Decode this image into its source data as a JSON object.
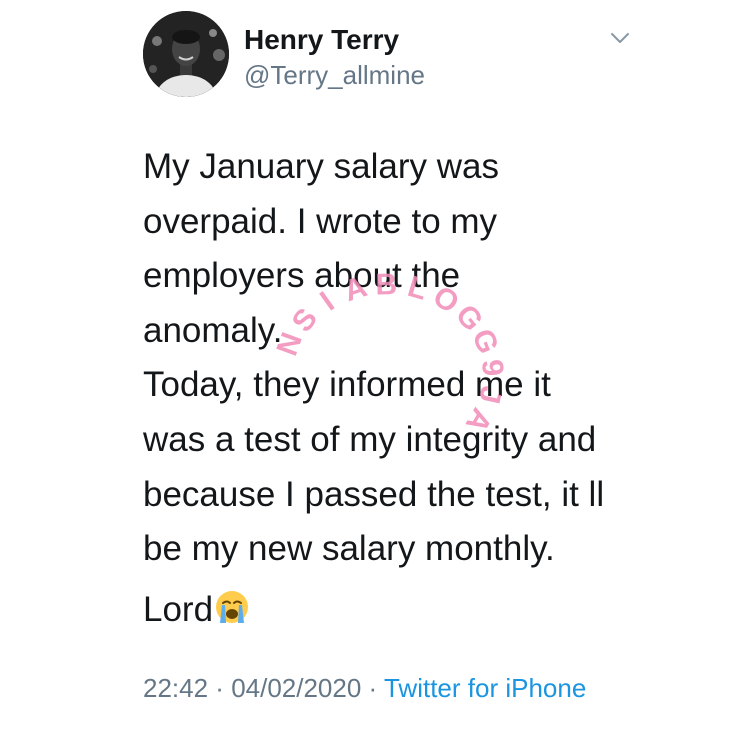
{
  "tweet": {
    "author": {
      "name": "Henry Terry",
      "handle": "@Terry_allmine"
    },
    "body_lines": [
      "My January salary was",
      "overpaid. I wrote to my",
      "employers about the",
      "anomaly.",
      "Today, they informed me it",
      "was a test of my integrity and",
      "because I passed the test, it ll",
      "be my new salary monthly."
    ],
    "closing_text": "Lord",
    "closing_emoji": "loudly-crying-face-emoji",
    "meta": {
      "time": "22:42",
      "separator": " · ",
      "date": "04/02/2020",
      "source": "Twitter for iPhone"
    }
  },
  "watermark": {
    "letters": [
      "N",
      "S",
      "I",
      "A",
      "B",
      "L",
      "O",
      "G",
      "G",
      "9",
      "J",
      "A"
    ],
    "color": "#f28cb8"
  },
  "colors": {
    "text": "#14171a",
    "secondary": "#657786",
    "link": "#1b95e0",
    "background": "#ffffff"
  },
  "icons": {
    "menu": "chevron-down-icon",
    "avatar": "profile-photo"
  }
}
